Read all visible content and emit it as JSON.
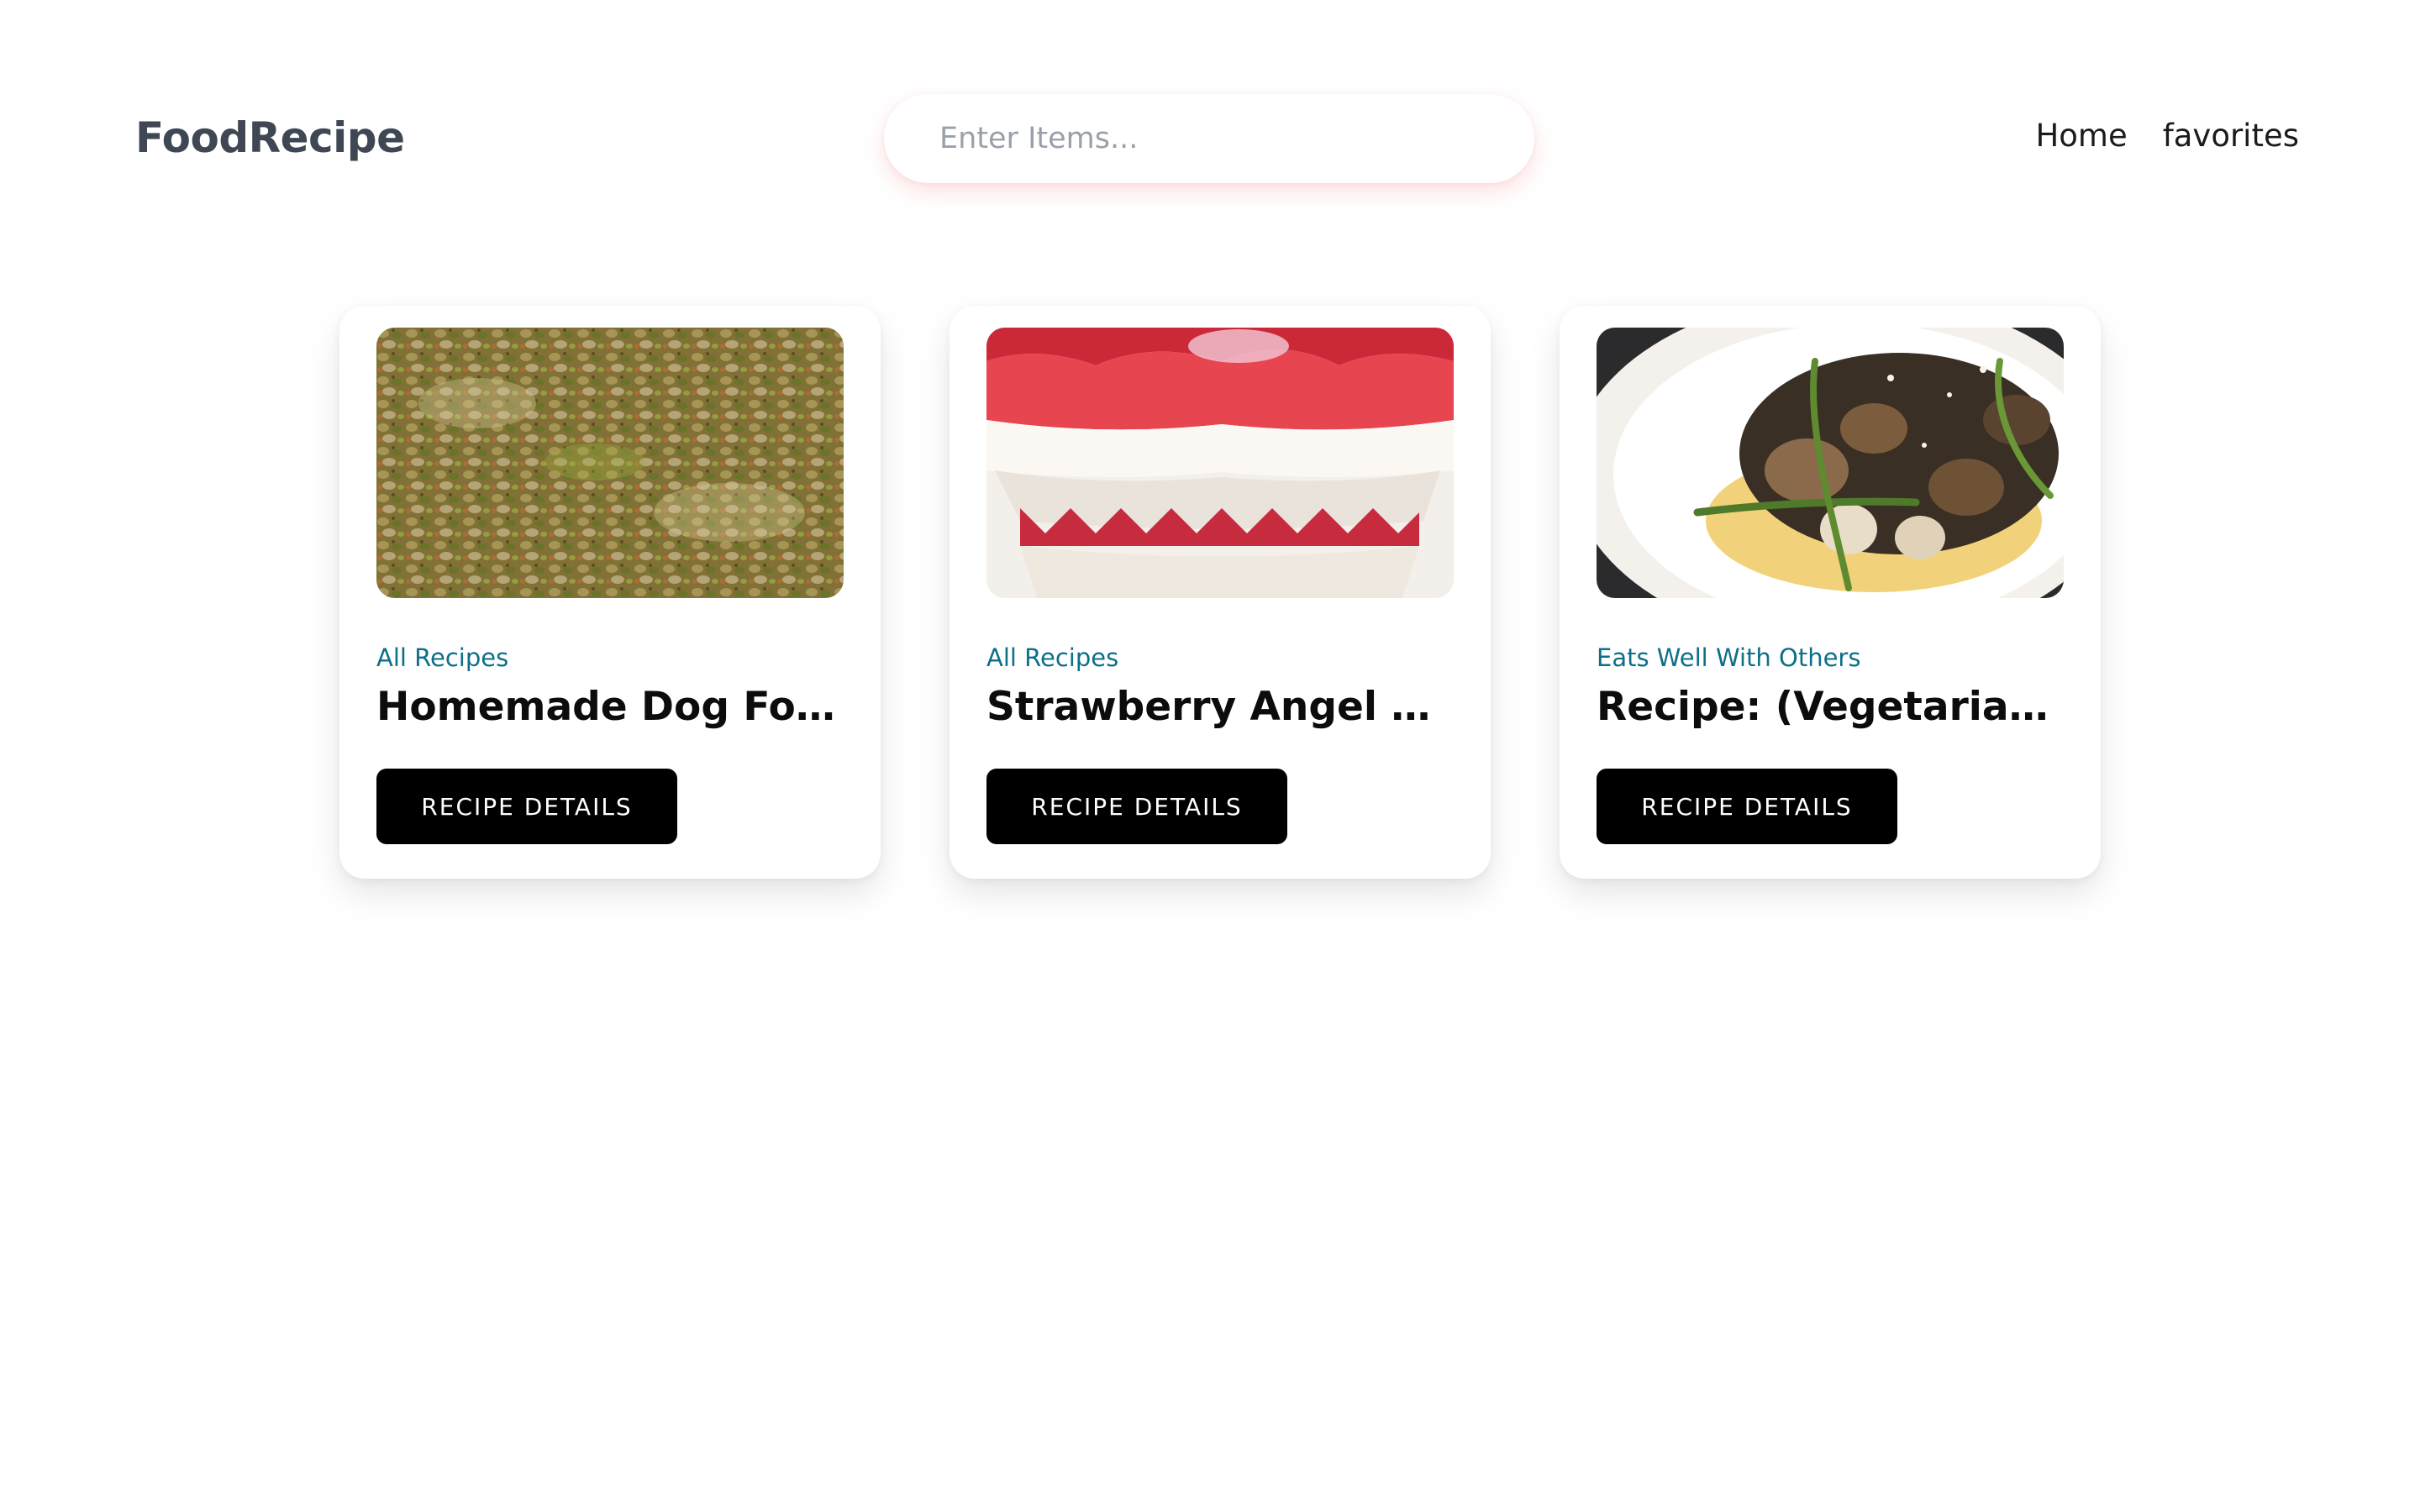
{
  "brand": "FoodRecipe",
  "search": {
    "placeholder": "Enter Items..."
  },
  "nav": {
    "home": "Home",
    "favorites": "favorites"
  },
  "recipes": [
    {
      "category": "All Recipes",
      "title": "Homemade Dog Food",
      "button": "RECIPE DETAILS",
      "image": "mixed-grain-dog-food-photo"
    },
    {
      "category": "All Recipes",
      "title": "Strawberry Angel Foo...",
      "button": "RECIPE DETAILS",
      "image": "strawberry-trifle-photo"
    },
    {
      "category": "Eats Well With Others",
      "title": "Recipe: (Vegetarian) C...",
      "button": "RECIPE DETAILS",
      "image": "vegetarian-stew-plate-photo"
    }
  ]
}
